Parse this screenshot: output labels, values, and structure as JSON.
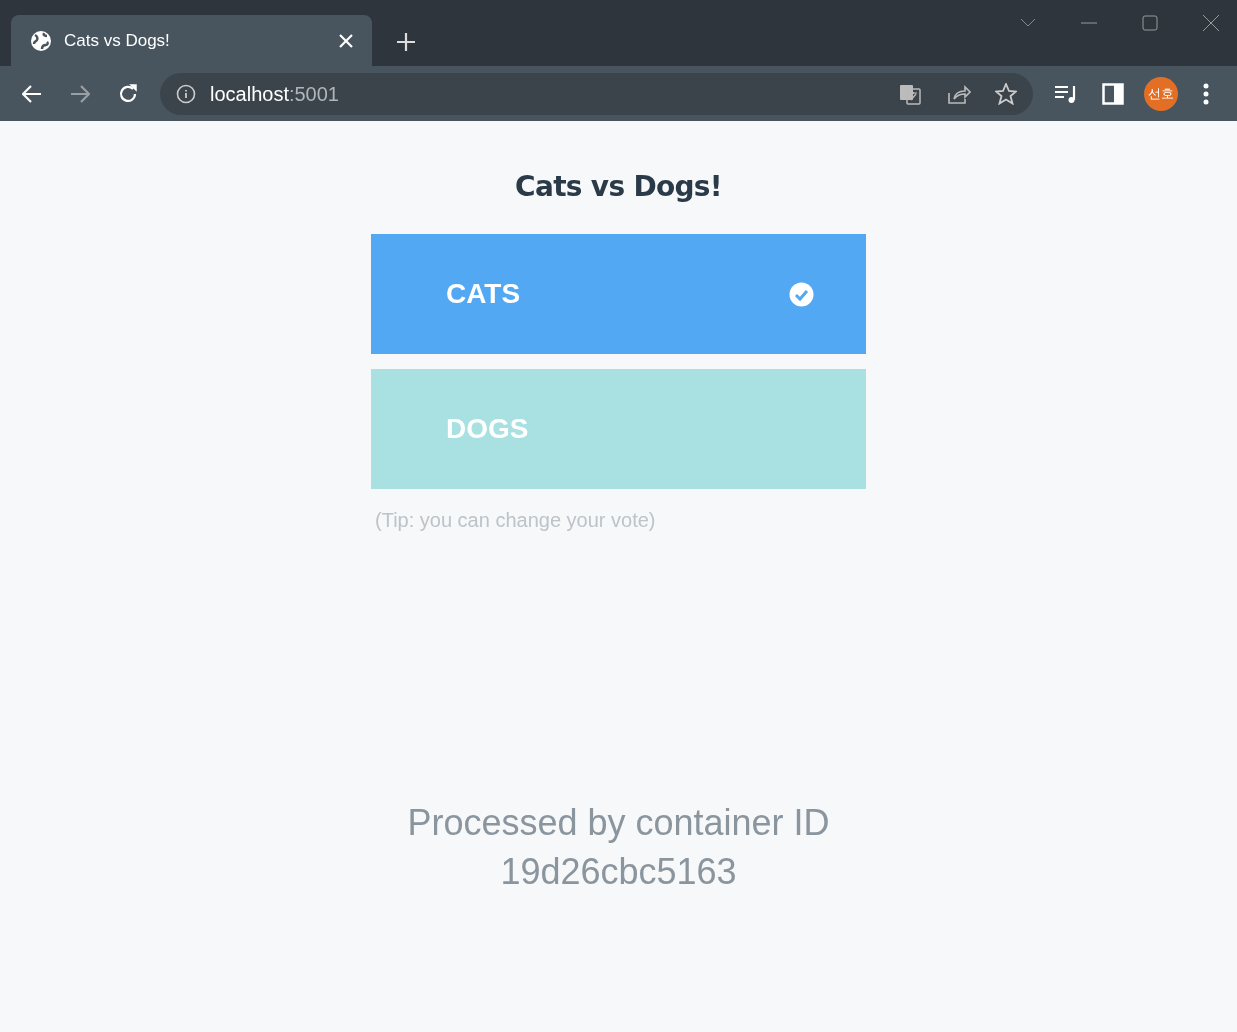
{
  "browser": {
    "tab": {
      "title": "Cats vs Dogs!"
    },
    "address": {
      "host": "localhost",
      "port": ":5001"
    },
    "profile": "선호"
  },
  "page": {
    "title": "Cats vs Dogs!",
    "options": [
      {
        "label": "CATS",
        "selected": true,
        "color": "#52a8f2"
      },
      {
        "label": "DOGS",
        "selected": false,
        "color": "#a9e0e1"
      }
    ],
    "tip": "(Tip: you can change your vote)",
    "footer": [
      "Processed by container ID",
      "19d26cbc5163"
    ]
  }
}
